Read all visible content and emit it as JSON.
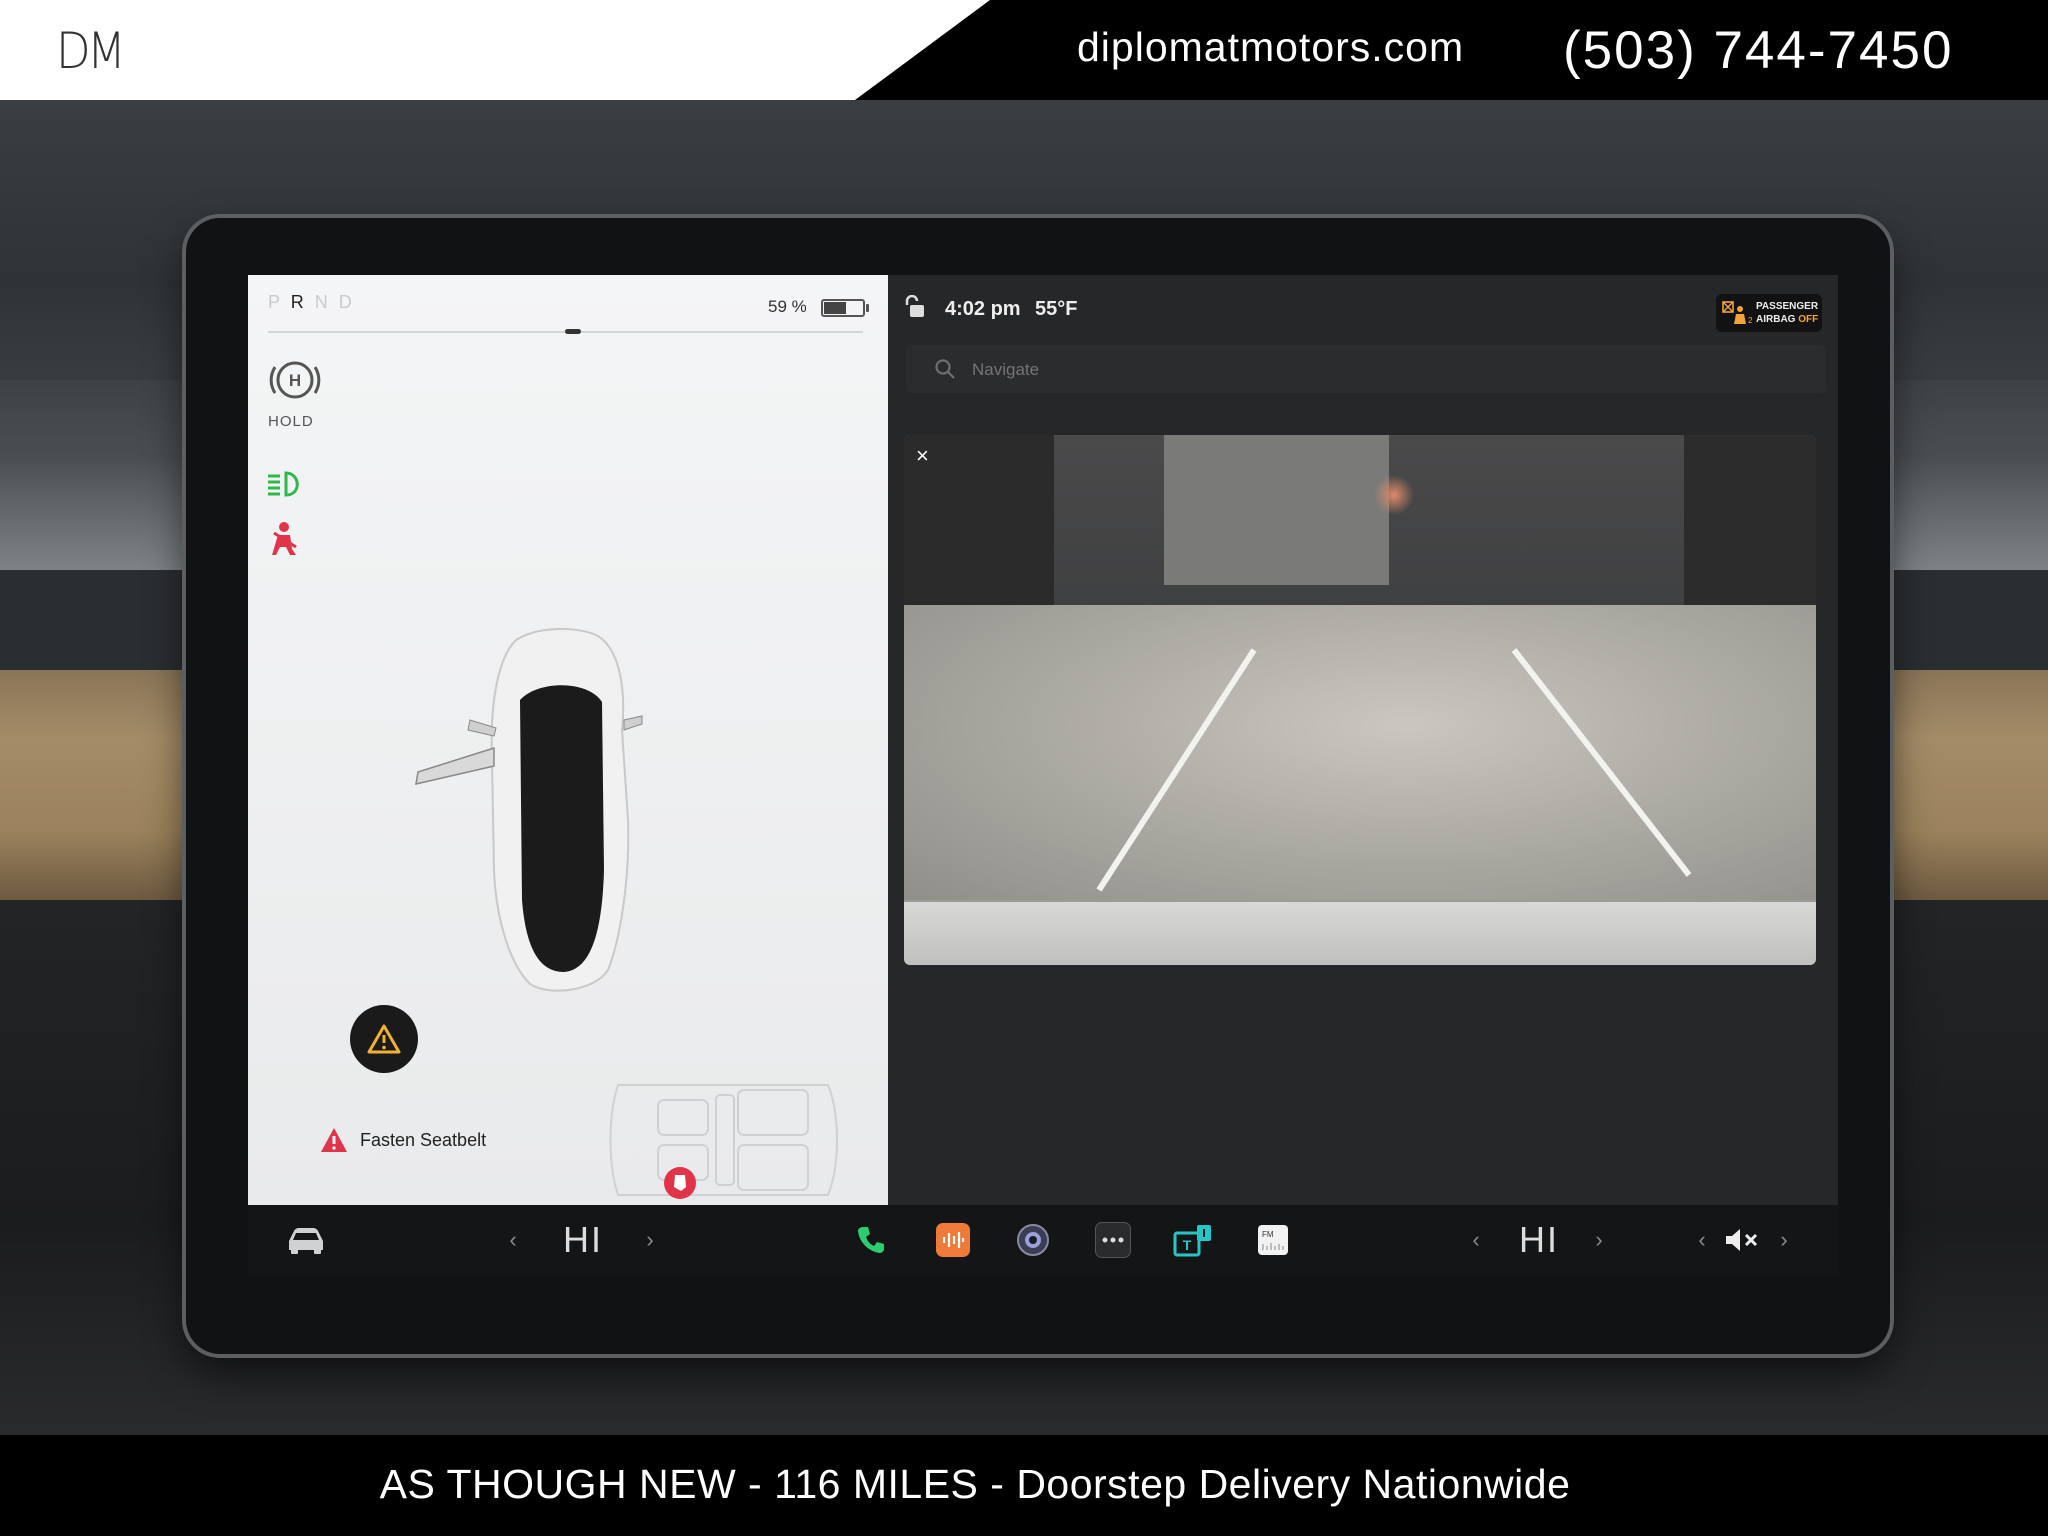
{
  "dealer": {
    "logo": "DM",
    "website": "diplomatmotors.com",
    "phone": "(503) 744-7450",
    "tagline": "AS THOUGH NEW - 116 MILES - Doorstep Delivery Nationwide"
  },
  "car_panel": {
    "gear": {
      "letters": [
        "P",
        "R",
        "N",
        "D"
      ],
      "selected": "R"
    },
    "battery_percent": "59 %",
    "battery_level": 0.59,
    "hold_label": "HOLD",
    "alert_text": "Fasten Seatbelt",
    "icons": [
      "hold-icon",
      "headlight-icon",
      "seatbelt-warning-icon",
      "warning-icon",
      "seat-occupancy-icon"
    ]
  },
  "status_bar": {
    "time": "4:02 pm",
    "temperature": "55°F",
    "airbag_line1": "PASSENGER",
    "airbag_line2": "AIRBAG",
    "airbag_state": "OFF"
  },
  "navigation": {
    "placeholder": "Navigate"
  },
  "camera": {
    "close_glyph": "×"
  },
  "dock": {
    "driver_temp": "HI",
    "passenger_temp": "HI",
    "apps": [
      "phone-icon",
      "audio-icon",
      "camera-icon",
      "more-icon",
      "toybox-icon",
      "radio-icon"
    ],
    "colors": {
      "phone": "#2ecc71",
      "audio": "#f07a3a",
      "toybox": "#26c6c6"
    },
    "volume_icon": "mute-icon"
  }
}
